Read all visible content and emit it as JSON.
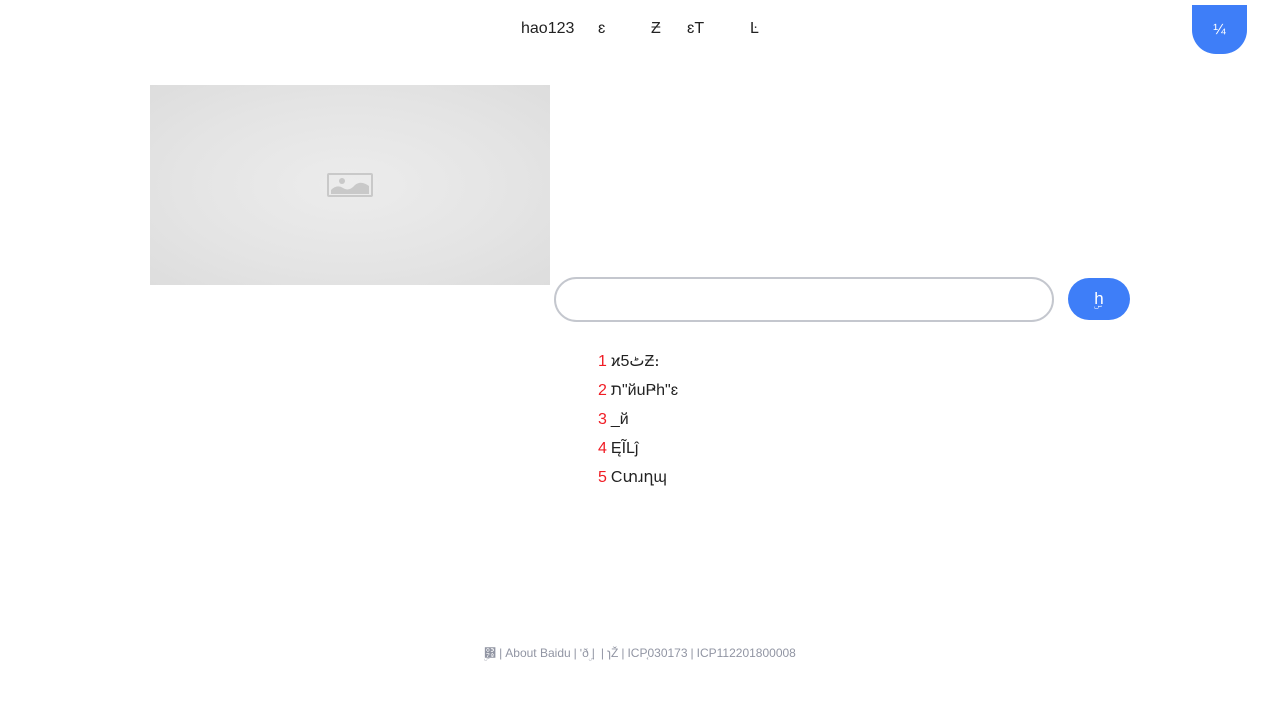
{
  "nav": {
    "links": [
      {
        "label": "hao123"
      },
      {
        "label": "ɛ"
      },
      {
        "label": "Ƶ"
      },
      {
        "label": "ɛT"
      },
      {
        "label": "Ŀ"
      }
    ],
    "login_label": "¼"
  },
  "logo": {
    "icon": "broken-image-icon"
  },
  "search": {
    "value": "",
    "placeholder": "",
    "button_label": "ۣh"
  },
  "hot_list": [
    {
      "rank": "1",
      "title": "ϰ5ٹƵ։"
    },
    {
      "rank": "2",
      "title": "ת\"йuҎh\"ɛ"
    },
    {
      "rank": "3",
      "title": "_й"
    },
    {
      "rank": "4",
      "title": "ĘĨLĵ"
    },
    {
      "rank": "5",
      "title": "Cտɹղɰ"
    }
  ],
  "footer": {
    "items": [
      {
        "label": "ۣ͸"
      },
      {
        "label": "About Baidu"
      },
      {
        "label": "ʹðۣ"
      },
      {
        "label": ""
      },
      {
        "label": "ɿŽ"
      },
      {
        "label": "ICP֤030173"
      },
      {
        "label": "ICP112201800008"
      }
    ],
    "separator": "|"
  },
  "colors": {
    "accent": "#3e7ef8",
    "hot_rank": "#f01c24",
    "footer_text": "#9195a3",
    "input_border": "#c4c7ce"
  }
}
